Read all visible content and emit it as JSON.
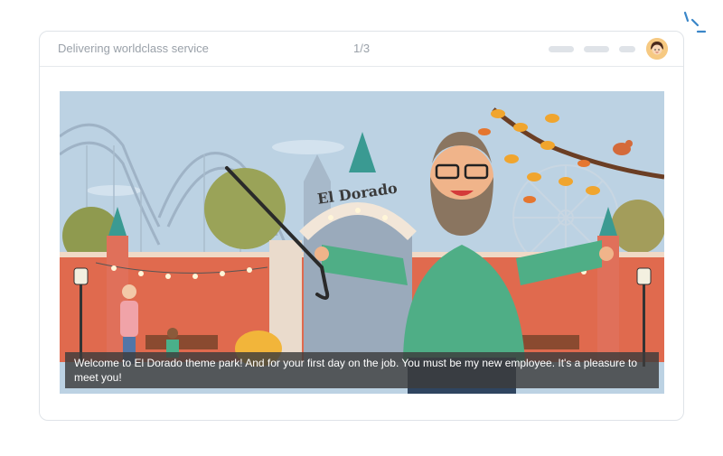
{
  "header": {
    "title": "Delivering worldclass service",
    "progress": "1/3"
  },
  "scene": {
    "sign_text": "El Dorado",
    "caption": "Welcome to El Dorado theme park! And for your first day on the job. You must be my new employee. It's a pleasure to meet you!"
  },
  "icons": {
    "avatar": "avatar-icon",
    "spark": "sparkle-icon"
  },
  "colors": {
    "accent": "#3a86c8",
    "wall": "#e06a4e",
    "sweater": "#4cae86"
  }
}
